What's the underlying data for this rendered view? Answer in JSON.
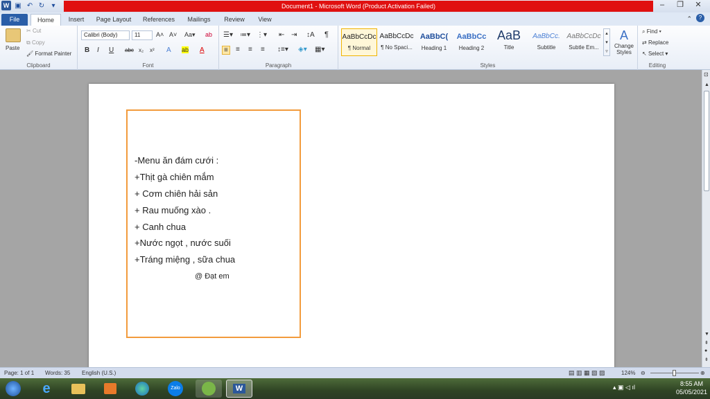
{
  "title": "Document1  -  Microsoft Word (Product Activation Failed)",
  "tabs": [
    "File",
    "Home",
    "Insert",
    "Page Layout",
    "References",
    "Mailings",
    "Review",
    "View"
  ],
  "clipboard": {
    "paste": "Paste",
    "cut": "Cut",
    "copy": "Copy",
    "format_painter": "Format Painter",
    "label": "Clipboard"
  },
  "font": {
    "name": "Calibri (Body)",
    "size": "11",
    "label": "Font"
  },
  "paragraph": {
    "label": "Paragraph"
  },
  "styles": {
    "items": [
      {
        "preview": "AaBbCcDc",
        "name": "¶ Normal"
      },
      {
        "preview": "AaBbCcDc",
        "name": "¶ No Spaci..."
      },
      {
        "preview": "AaBbC(",
        "name": "Heading 1"
      },
      {
        "preview": "AaBbCc",
        "name": "Heading 2"
      },
      {
        "preview": "AaB",
        "name": "Title"
      },
      {
        "preview": "AaBbCc.",
        "name": "Subtitle"
      },
      {
        "preview": "AaBbCcDc",
        "name": "Subtle Em..."
      }
    ],
    "change": "Change Styles",
    "label": "Styles"
  },
  "editing": {
    "find": "Find",
    "replace": "Replace",
    "select": "Select",
    "label": "Editing"
  },
  "document": {
    "lines": [
      "-Menu ăn đám cưới :",
      "+Thịt gà  chiên mắm",
      "+ Cơm chiên hải sản",
      "+ Rau muống xào .",
      "+ Canh  chua",
      " +Nước ngọt , nước suối",
      "+Tráng miệng , sữa chua"
    ],
    "signature": "@ Đạt em"
  },
  "status": {
    "page": "Page: 1 of 1",
    "words": "Words: 35",
    "lang": "English (U.S.)",
    "zoom": "124%"
  },
  "taskbar": {
    "icons": [
      "start-orb",
      "internet-explorer",
      "file-explorer",
      "media-player",
      "edge",
      "Zalo",
      "greenshot",
      "word"
    ]
  },
  "clock": {
    "time": "8:55 AM",
    "date": "05/05/2021"
  },
  "colors": {
    "title_red": "#e01010",
    "frame_orange": "#f29b3c",
    "file_tab": "#2a5ea8"
  }
}
